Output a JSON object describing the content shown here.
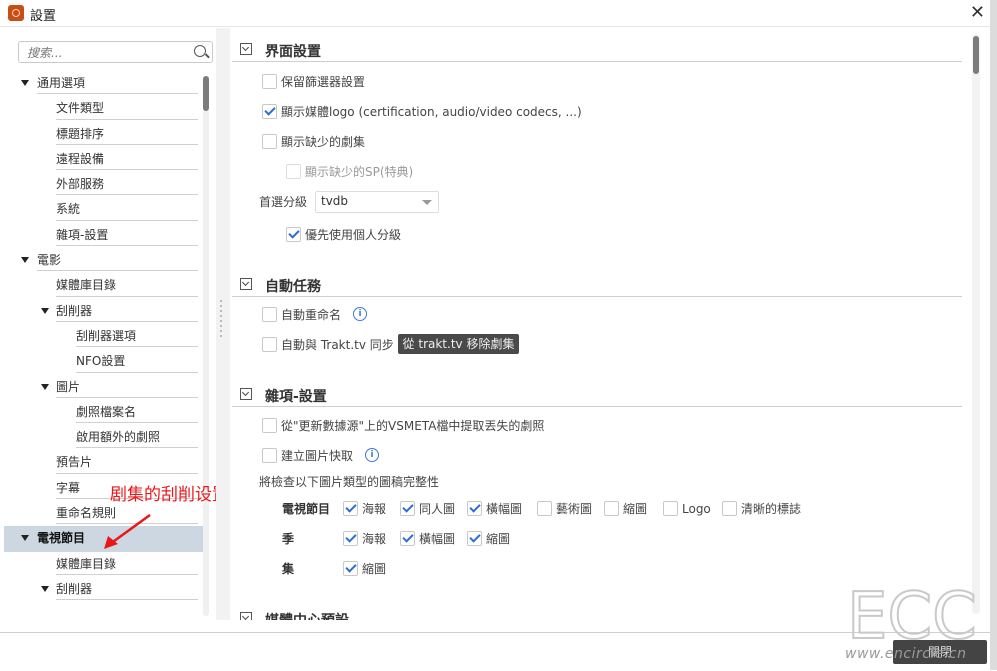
{
  "window": {
    "title": "設置"
  },
  "sidebar": {
    "search_placeholder": "搜索...",
    "items": [
      {
        "label": "通用選項",
        "level": 0,
        "caret": true
      },
      {
        "label": "文件類型",
        "level": 1
      },
      {
        "label": "標題排序",
        "level": 1
      },
      {
        "label": "遠程設備",
        "level": 1
      },
      {
        "label": "外部服務",
        "level": 1
      },
      {
        "label": "系統",
        "level": 1
      },
      {
        "label": "雜項-設置",
        "level": 1
      },
      {
        "label": "電影",
        "level": 0,
        "caret": true
      },
      {
        "label": "媒體庫目錄",
        "level": 1
      },
      {
        "label": "刮削器",
        "level": 1,
        "caret": true
      },
      {
        "label": "刮削器選項",
        "level": 2
      },
      {
        "label": "NFO設置",
        "level": 2
      },
      {
        "label": "圖片",
        "level": 1,
        "caret": true
      },
      {
        "label": "劇照檔案名",
        "level": 2
      },
      {
        "label": "啟用額外的劇照",
        "level": 2
      },
      {
        "label": "預告片",
        "level": 1
      },
      {
        "label": "字幕",
        "level": 1
      },
      {
        "label": "重命名規則",
        "level": 1
      },
      {
        "label": "電視節目",
        "level": 0,
        "caret": true,
        "selected": true
      },
      {
        "label": "媒體庫目錄",
        "level": 1
      },
      {
        "label": "刮削器",
        "level": 1,
        "caret": true
      }
    ]
  },
  "annotation": {
    "text": "剧集的刮削设置"
  },
  "sections": {
    "ui": {
      "title": "界面設置",
      "keep_filter": "保留篩選器設置",
      "show_logo": "顯示媒體logo (certification, audio/video codecs, ...)",
      "show_missing": "顯示缺少的劇集",
      "show_missing_sp": "顯示缺少的SP(特典)",
      "rating_label": "首選分級",
      "rating_value": "tvdb",
      "prefer_personal": "優先使用個人分級"
    },
    "auto": {
      "title": "自動任務",
      "auto_rename": "自動重命名",
      "trakt_sync": "自動與 Trakt.tv 同步",
      "trakt_remove": "從 trakt.tv 移除劇集"
    },
    "misc": {
      "title": "雜項-設置",
      "vsmeta": "從\"更新數據源\"上的VSMETA檔中提取丟失的劇照",
      "image_cache": "建立圖片快取",
      "check_label": "將檢查以下圖片類型的圖稿完整性",
      "tvshow_label": "電視節目",
      "season_label": "季",
      "episode_label": "集",
      "tvshow_opts": [
        "海報",
        "同人圖",
        "橫幅圖",
        "藝術圖",
        "縮圖",
        "Logo",
        "清晰的標誌"
      ],
      "season_opts": [
        "海報",
        "橫幅圖",
        "縮圖"
      ],
      "episode_opts": [
        "縮圖"
      ]
    },
    "next": {
      "title": "媒體中心預設"
    }
  },
  "footer": {
    "close_label": "關閉"
  },
  "watermark": {
    "logo": "ECC",
    "url": "www.encircle.cn"
  }
}
